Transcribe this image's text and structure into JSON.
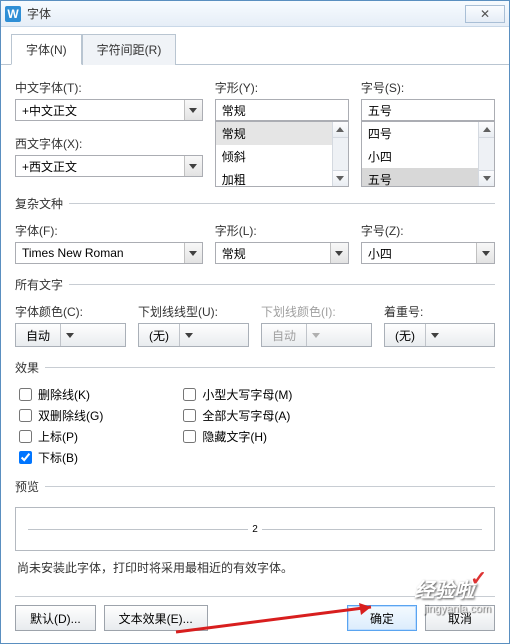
{
  "window": {
    "title": "字体",
    "icon_label": "W",
    "close_label": "✕"
  },
  "tabs": {
    "font": "字体(N)",
    "spacing": "字符间距(R)"
  },
  "main": {
    "cn_font_label": "中文字体(T):",
    "cn_font_value": "+中文正文",
    "style_label": "字形(Y):",
    "style_value": "常规",
    "style_options": [
      "常规",
      "倾斜",
      "加粗"
    ],
    "size_label": "字号(S):",
    "size_value": "五号",
    "size_options": [
      "四号",
      "小四",
      "五号"
    ],
    "en_font_label": "西文字体(X):",
    "en_font_value": "+西文正文"
  },
  "complex": {
    "legend": "复杂文种",
    "font_label": "字体(F):",
    "font_value": "Times New Roman",
    "style_label": "字形(L):",
    "style_value": "常规",
    "size_label": "字号(Z):",
    "size_value": "小四"
  },
  "alltext": {
    "legend": "所有文字",
    "color_label": "字体颜色(C):",
    "color_value": "自动",
    "underline_label": "下划线线型(U):",
    "underline_value": "(无)",
    "ucolor_label": "下划线颜色(I):",
    "ucolor_value": "自动",
    "emphasis_label": "着重号:",
    "emphasis_value": "(无)"
  },
  "effects": {
    "legend": "效果",
    "strike": "删除线(K)",
    "dstrike": "双删除线(G)",
    "sup": "上标(P)",
    "sub": "下标(B)",
    "smallcaps": "小型大写字母(M)",
    "allcaps": "全部大写字母(A)",
    "hidden": "隐藏文字(H)"
  },
  "preview": {
    "legend": "预览",
    "sample": "2"
  },
  "note": "尚未安装此字体，打印时将采用最相近的有效字体。",
  "footer": {
    "default_btn": "默认(D)...",
    "text_effect_btn": "文本效果(E)...",
    "ok": "确定",
    "cancel": "取消"
  },
  "watermark": {
    "text": "经验啦",
    "url": "jingyanla.com"
  }
}
